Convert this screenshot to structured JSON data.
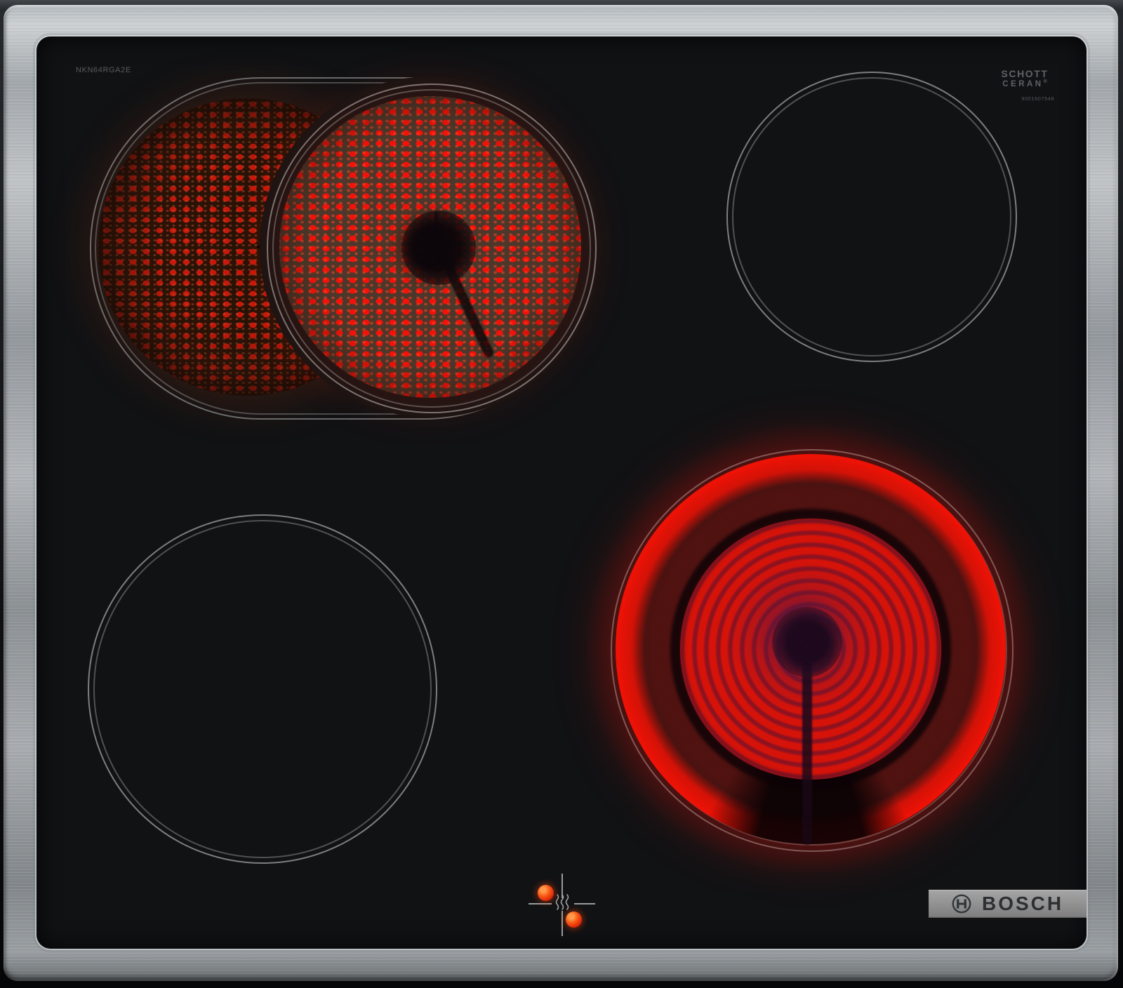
{
  "product": {
    "model": "NKN64RGA2E"
  },
  "glass_branding": {
    "maker_line1": "SCHOTT",
    "maker_line2": "CERAN",
    "registered_mark": "®",
    "print_number": "9001607548"
  },
  "brand": {
    "name": "BOSCH"
  },
  "zones": {
    "back_left": {
      "label": "dual extension zone",
      "state": "on"
    },
    "back_right": {
      "label": "single zone",
      "state": "off"
    },
    "front_left": {
      "label": "single zone",
      "state": "off"
    },
    "front_right": {
      "label": "dual circuit zone",
      "state": "on"
    }
  },
  "indicators": {
    "residual_heat_icon": "≋",
    "dot_count": 2
  },
  "colors": {
    "heat_ring_red": "#ee1206",
    "halftone_red": "#f51408",
    "indicator_orange": "#f95c17",
    "steel": "#a7acb1",
    "glass_black": "#111214",
    "badge_gray": "#8f8f8f"
  }
}
